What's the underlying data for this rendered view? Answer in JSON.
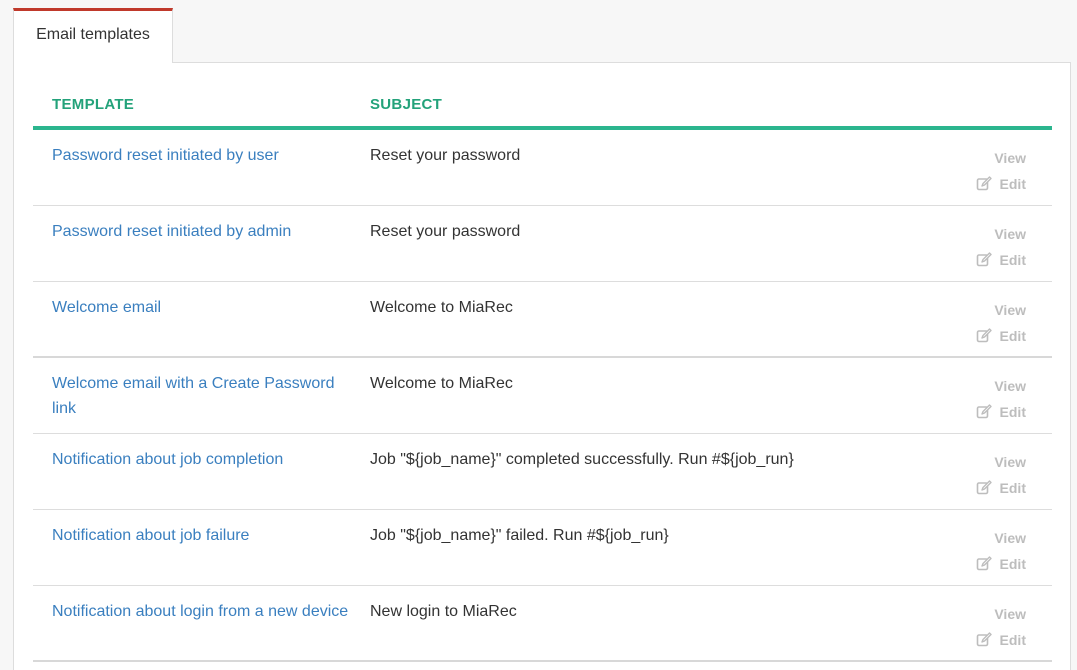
{
  "tabs": [
    {
      "label": "Email templates",
      "active": true
    }
  ],
  "table": {
    "headers": {
      "template": "TEMPLATE",
      "subject": "SUBJECT"
    },
    "actions": {
      "view": "View",
      "edit": "Edit"
    },
    "rows": [
      {
        "template": "Password reset initiated by user",
        "subject": "Reset your password"
      },
      {
        "template": "Password reset initiated by admin",
        "subject": "Reset your password"
      },
      {
        "template": "Welcome email",
        "subject": "Welcome to MiaRec"
      },
      {
        "template": "Welcome email with a Create Password link",
        "subject": "Welcome to MiaRec"
      },
      {
        "template": "Notification about job completion",
        "subject": "Job \"${job_name}\" completed successfully. Run #${job_run}"
      },
      {
        "template": "Notification about job failure",
        "subject": "Job \"${job_name}\" failed. Run #${job_run}"
      },
      {
        "template": "Notification about login from a new device",
        "subject": "New login to MiaRec"
      }
    ]
  },
  "colors": {
    "tab_accent": "#c0392b",
    "header_text": "#23a27a",
    "header_rule": "#2bb58e",
    "link": "#3a7fbf",
    "action_muted": "#bdbdbd"
  },
  "icons": {
    "edit": "edit-icon"
  }
}
